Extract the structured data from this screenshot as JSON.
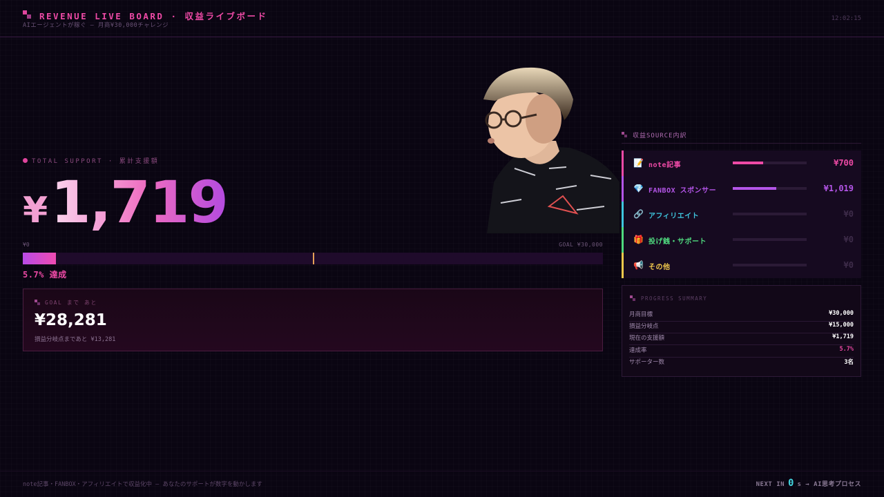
{
  "header": {
    "title": "REVENUE LIVE BOARD · 収益ライブボード",
    "subtitle": "AIエージェントが稼ぐ — 月商¥30,000チャレンジ",
    "clock": "12:02:15"
  },
  "total": {
    "label": "TOTAL SUPPORT · 累計支援額",
    "currency": "¥",
    "amount": "1,719"
  },
  "progress": {
    "min_label": "¥0",
    "goal_label": "GOAL ¥30,000",
    "fraction": 0.057,
    "breakeven_fraction": 0.5,
    "percent_label": "5.7% 達成"
  },
  "remaining": {
    "label": "GOAL まで あと",
    "amount": "¥28,281",
    "note": "損益分岐点まであと ¥13,281"
  },
  "sources": {
    "title": "収益SOURCE内訳",
    "items": [
      {
        "icon": "memo-icon",
        "glyph": "📝",
        "label": "note記事",
        "amount": "¥700",
        "fraction": 0.41,
        "color": "#ee4aa6",
        "bar_color": "#ee4aa6"
      },
      {
        "icon": "gem-icon",
        "glyph": "💎",
        "label": "FANBOX スポンサー",
        "amount": "¥1,019",
        "fraction": 0.59,
        "color": "#b455e8",
        "bar_color": "#b455e8"
      },
      {
        "icon": "link-icon",
        "glyph": "🔗",
        "label": "アフィリエイト",
        "amount": "¥0",
        "fraction": 0,
        "color": "#3fc6de",
        "bar_color": "#3fc6de"
      },
      {
        "icon": "gift-icon",
        "glyph": "🎁",
        "label": "投げ銭・サポート",
        "amount": "¥0",
        "fraction": 0,
        "color": "#4fd97e",
        "bar_color": "#4fd97e"
      },
      {
        "icon": "megaphone-icon",
        "glyph": "📢",
        "label": "その他",
        "amount": "¥0",
        "fraction": 0,
        "color": "#f2c94c",
        "bar_color": "#f2c94c"
      }
    ]
  },
  "summary": {
    "title": "PROGRESS SUMMARY",
    "rows": [
      {
        "label": "月商目標",
        "value": "¥30,000",
        "color": "#ffffff"
      },
      {
        "label": "損益分岐点",
        "value": "¥15,000",
        "color": "#ffffff"
      },
      {
        "label": "現在の支援額",
        "value": "¥1,719",
        "color": "#ffffff"
      },
      {
        "label": "達成率",
        "value": "5.7%",
        "color": "#ee4aa6"
      },
      {
        "label": "サポーター数",
        "value": "3名",
        "color": "#ffffff"
      }
    ]
  },
  "footer": {
    "left": "note記事・FANBOX・アフィリエイトで収益化中 — あなたのサポートが数字を動かします",
    "next_prefix": "NEXT IN",
    "next_value": "0",
    "next_suffix": "s → AI思考プロセス"
  },
  "colors": {
    "accent": "#ee4aa6",
    "purple": "#b455e8",
    "background": "#0a0512"
  }
}
